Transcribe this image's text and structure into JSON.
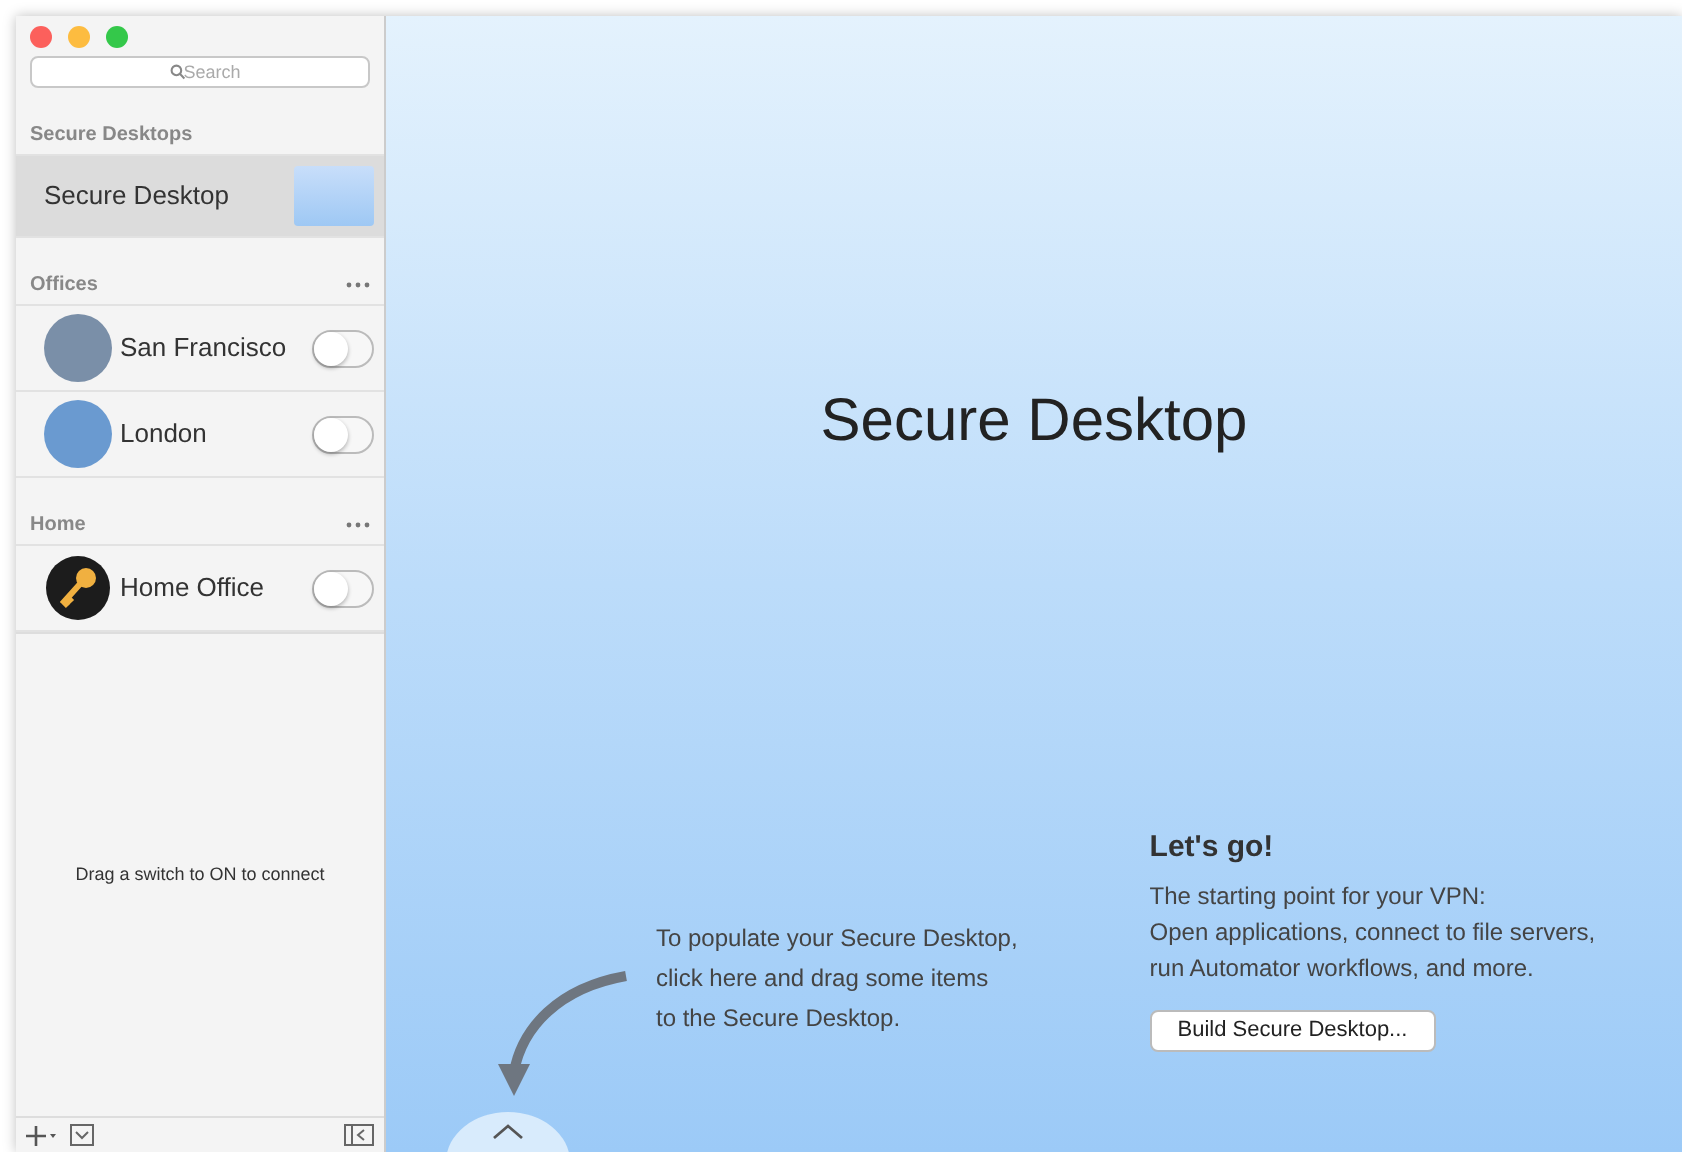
{
  "search": {
    "placeholder": "Search"
  },
  "sections": [
    {
      "title": "Secure Desktops",
      "has_more": false,
      "items": [
        {
          "kind": "desktop",
          "label": "Secure Desktop",
          "selected": true
        }
      ]
    },
    {
      "title": "Offices",
      "has_more": true,
      "items": [
        {
          "kind": "photo",
          "label": "San Francisco",
          "selected": false,
          "on": false,
          "color": "#7a8fa8"
        },
        {
          "kind": "photo",
          "label": "London",
          "selected": false,
          "on": false,
          "color": "#6a9ad0"
        }
      ]
    },
    {
      "title": "Home",
      "has_more": true,
      "items": [
        {
          "kind": "key",
          "label": "Home Office",
          "selected": false,
          "on": false
        }
      ]
    }
  ],
  "status": "Drag a switch to ON to connect",
  "main": {
    "title": "Secure Desktop",
    "hint_lines": [
      "To populate your Secure Desktop,",
      "click here and drag some items",
      "to the Secure Desktop."
    ],
    "intro_title": "Let's go!",
    "intro_lines": [
      "The starting point for your VPN:",
      "Open applications, connect to file servers,",
      "run Automator workflows, and more."
    ],
    "button": "Build Secure Desktop..."
  }
}
